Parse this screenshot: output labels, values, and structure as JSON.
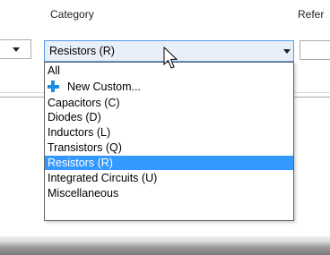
{
  "labels": {
    "category": "Category",
    "reference": "Refer"
  },
  "category_combo": {
    "value": "Resistors (R)",
    "icon": "chevron-down-icon"
  },
  "dropdown": {
    "options": [
      {
        "label": "All"
      },
      {
        "label": "New Custom...",
        "icon": "plus-icon"
      },
      {
        "label": "Capacitors (C)"
      },
      {
        "label": "Diodes (D)"
      },
      {
        "label": "Inductors (L)"
      },
      {
        "label": "Transistors (Q)"
      },
      {
        "label": "Resistors (R)",
        "selected": true
      },
      {
        "label": "Integrated Circuits (U)"
      },
      {
        "label": "Miscellaneous"
      }
    ]
  },
  "colors": {
    "selection": "#3399ff",
    "combo_focus_border": "#569de5",
    "combo_focus_bg": "#e9eff8",
    "plus_icon": "#1e8fe0"
  }
}
